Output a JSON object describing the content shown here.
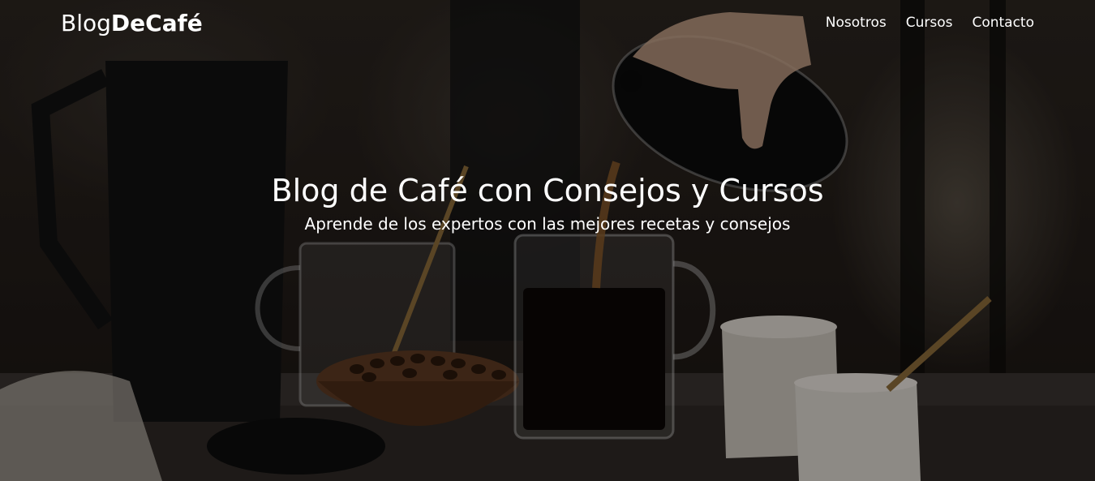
{
  "header": {
    "logo_regular": "Blog",
    "logo_bold": "DeCafé",
    "nav": [
      {
        "label": "Nosotros"
      },
      {
        "label": "Cursos"
      },
      {
        "label": "Contacto"
      }
    ]
  },
  "hero": {
    "title": "Blog de Café con Consejos y Cursos",
    "subtitle": "Aprende de los expertos con las mejores recetas y consejos",
    "background_image": "coffee-pouring-scene",
    "overlay_color": "#000000"
  }
}
